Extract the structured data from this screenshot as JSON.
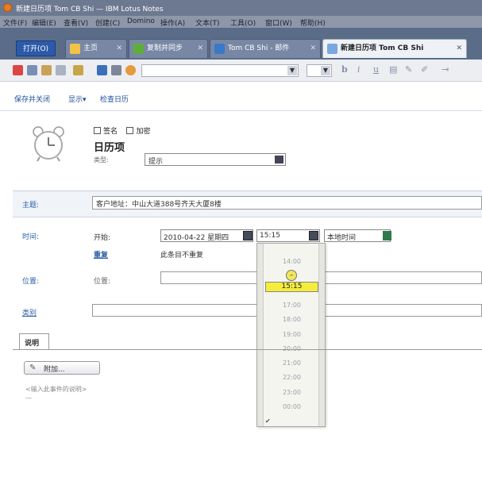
{
  "window": {
    "title": "新建日历项 Tom CB Shi — IBM Lotus Notes"
  },
  "menu": [
    "文件(F)",
    "编辑(E)",
    "查看(V)",
    "创建(C)",
    "Domino",
    "操作(A)",
    "文本(T)",
    "工具(O)",
    "窗口(W)",
    "帮助(H)"
  ],
  "tabbar": {
    "open_label": "打开(O)",
    "tabs": [
      {
        "label": "主页",
        "icon": "home-icon",
        "color": "#f2c24a"
      },
      {
        "label": "复制并同步",
        "icon": "replication-icon",
        "color": "#5fae3c"
      },
      {
        "label": "Tom CB Shi - 邮件",
        "icon": "mail-icon",
        "color": "#3a78c8"
      },
      {
        "label": "新建日历项 Tom CB Shi",
        "icon": "calendar-icon",
        "color": "#7aa7de"
      }
    ]
  },
  "actions": {
    "save_close": "保存并关闭",
    "display": "显示▾",
    "check_calendar": "检查日历"
  },
  "header": {
    "sign_label": "签名",
    "encrypt_label": "加密",
    "title": "日历项",
    "type_label": "类型:",
    "type_value": "提示"
  },
  "fields": {
    "subject_label": "主题:",
    "subject_value": "客户地址：中山大道388号齐天大厦8楼",
    "time_label": "时间:",
    "start_label": "开始:",
    "start_date": "2010-04-22 星期四",
    "start_time": "15:15",
    "timezone": "本地时间",
    "repeat_link": "重复",
    "repeat_text": "此条目不重复",
    "location_label": "位置:",
    "location_sub": "位置:",
    "category_link": "类别"
  },
  "time_dropdown": {
    "times_before": [
      "14:00"
    ],
    "selected": "15:15",
    "times_after": [
      "17:00",
      "18:00",
      "19:00",
      "20:00",
      "21:00",
      "22:00",
      "23:00",
      "00:00"
    ]
  },
  "description": {
    "tab_label": "说明",
    "attach_label": "附加...",
    "placeholder": "<输入此事件的说明>",
    "dash": "—"
  },
  "colors": {
    "accent_link": "#2d5fa8",
    "tab_bar": "#5a6c88",
    "highlight": "#f4ed3c"
  }
}
